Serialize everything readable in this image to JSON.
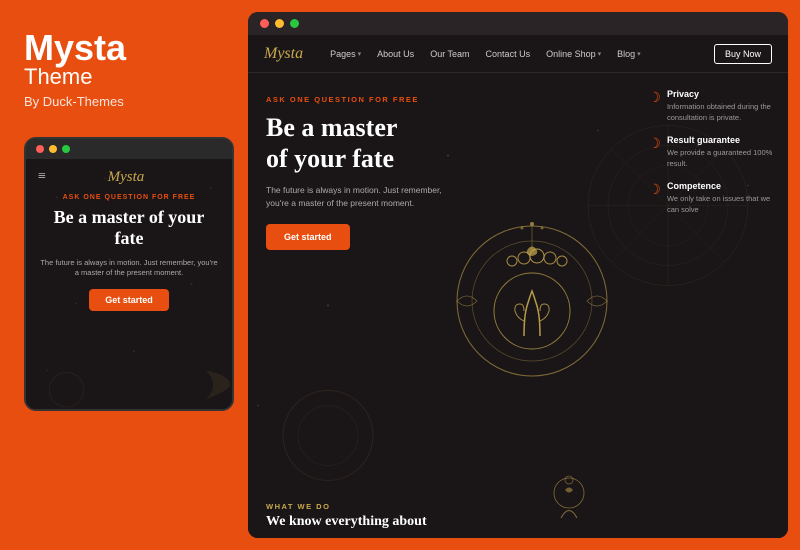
{
  "brand": {
    "name": "Mysta",
    "subtitle": "Theme",
    "by": "By Duck-Themes"
  },
  "nav": {
    "logo": "Mysta",
    "links": [
      {
        "label": "Pages",
        "has_dropdown": true
      },
      {
        "label": "About Us",
        "has_dropdown": false
      },
      {
        "label": "Our Team",
        "has_dropdown": false
      },
      {
        "label": "Contact Us",
        "has_dropdown": false
      },
      {
        "label": "Online Shop",
        "has_dropdown": true
      },
      {
        "label": "Blog",
        "has_dropdown": true
      }
    ],
    "buy_now": "Buy Now"
  },
  "hero": {
    "ask_label": "ASK ONE QUESTION FOR FREE",
    "heading_line1": "Be a master",
    "heading_line2": "of your fate",
    "description": "The future is always in motion. Just remember,\nyou're a master of the present moment.",
    "cta": "Get started"
  },
  "features": [
    {
      "icon": "crescent",
      "title": "Privacy",
      "description": "Information obtained during the consultation is private."
    },
    {
      "icon": "crescent",
      "title": "Result guarantee",
      "description": "We provide a guaranteed 100% result."
    },
    {
      "icon": "crescent",
      "title": "Competence",
      "description": "We only take on issues that we can solve"
    }
  ],
  "bottom_section": {
    "label": "WHAT WE DO",
    "heading": "We know everything about"
  },
  "mobile": {
    "logo": "Mysta",
    "ask_label": "ASK ONE QUESTION FOR FREE",
    "heading": "Be a master of your fate",
    "description": "The future is always in motion. Just remember, you're a master of the present moment.",
    "cta": "Get started"
  },
  "colors": {
    "brand_orange": "#e84e0f",
    "dark_bg": "#1a1618",
    "gold": "#c9a84c",
    "text_muted": "#999",
    "white": "#ffffff"
  }
}
